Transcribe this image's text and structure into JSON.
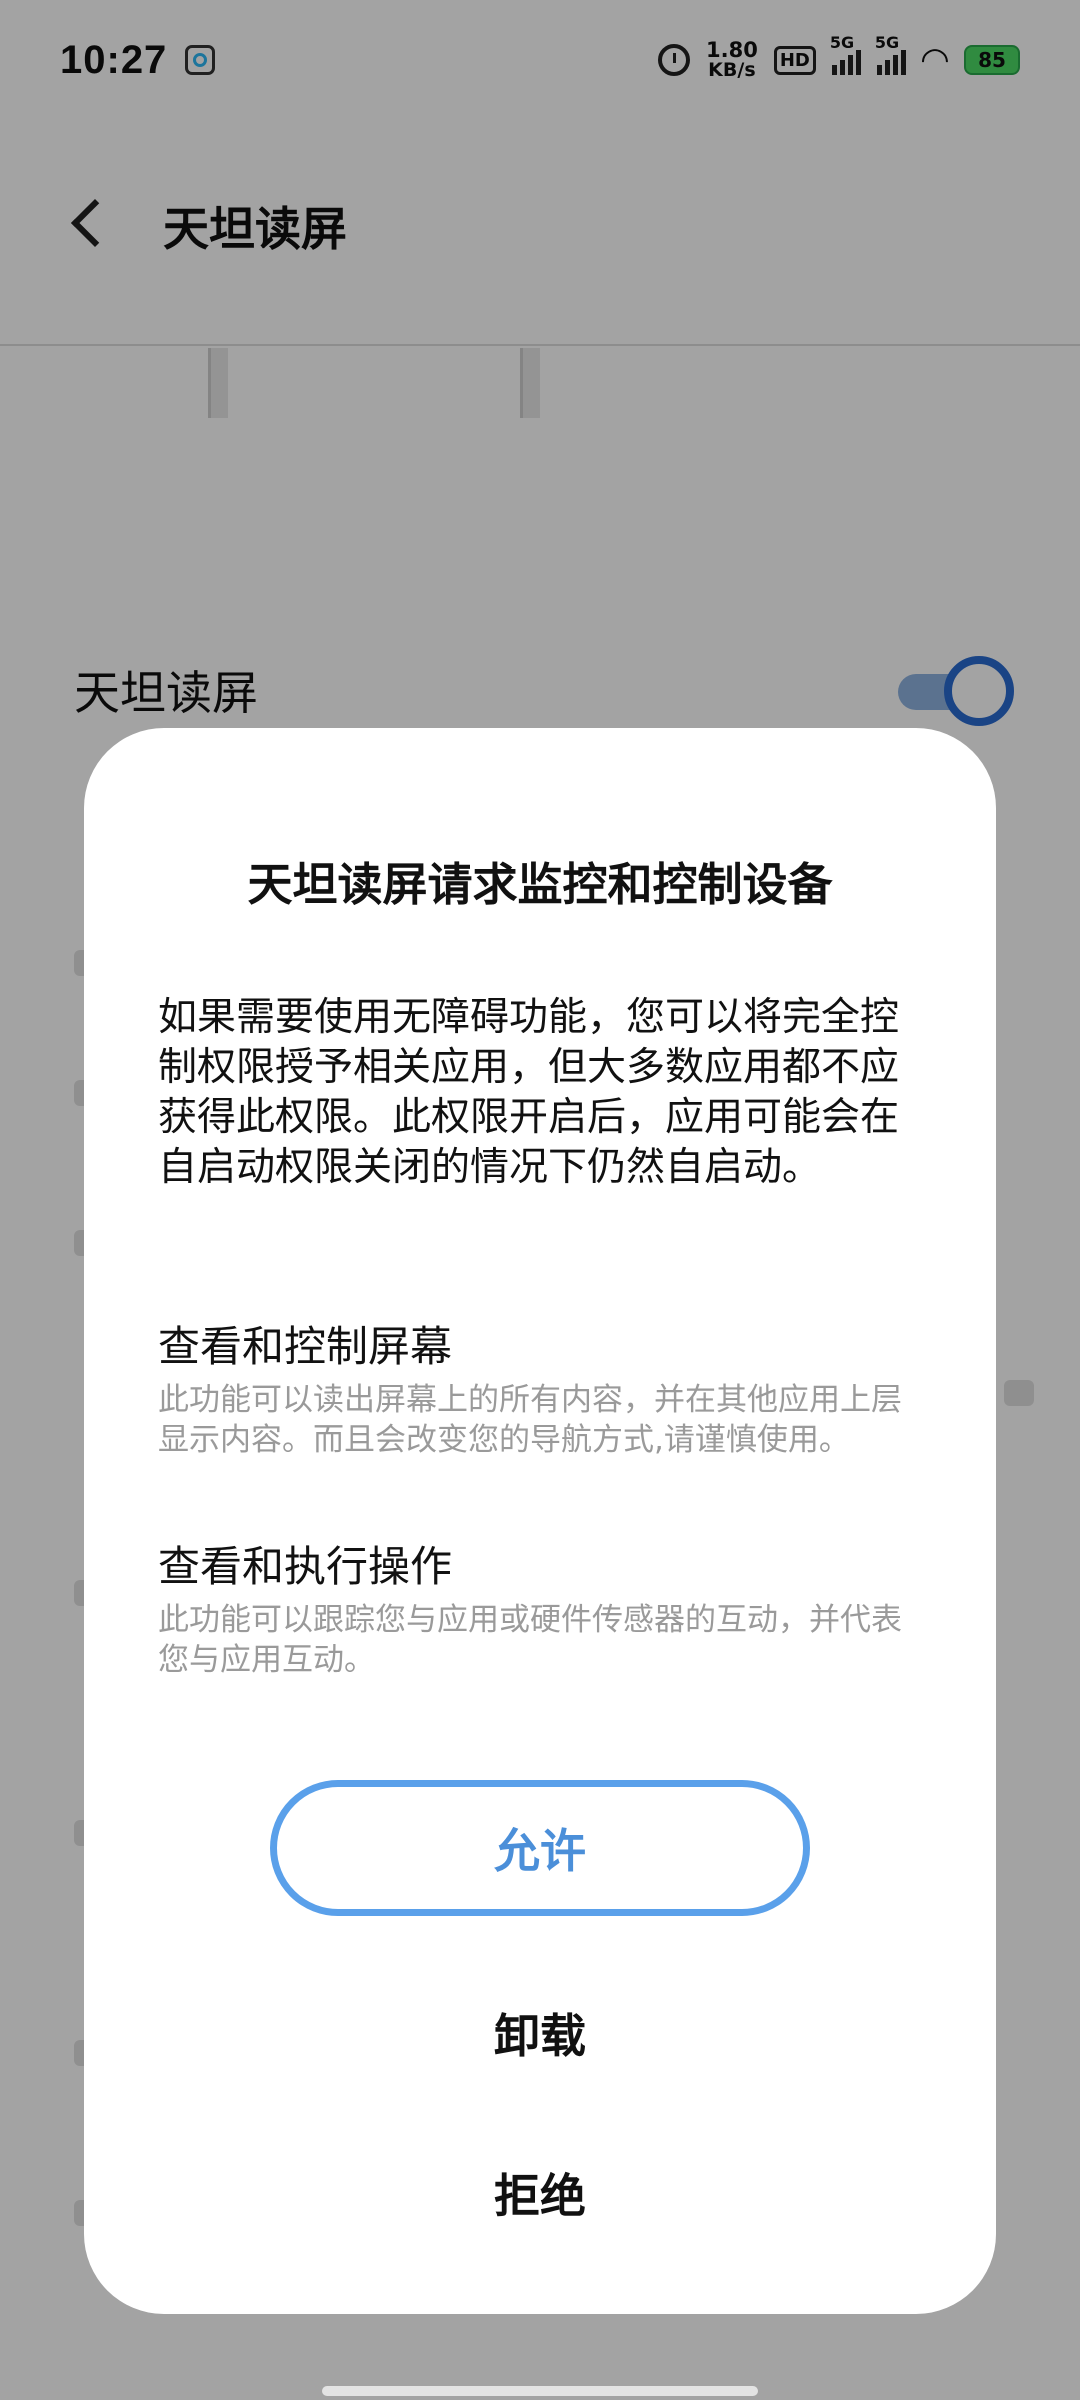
{
  "status_bar": {
    "time": "10:27",
    "net_speed_value": "1.80",
    "net_speed_unit": "KB/s",
    "hd_label": "HD",
    "signal_1_label": "5G",
    "signal_2_label": "5G",
    "battery_level": "85"
  },
  "header": {
    "title": "天坦读屏"
  },
  "background": {
    "service_label": "天坦读屏",
    "toggle_on": true
  },
  "dialog": {
    "title": "天坦读屏请求监控和控制设备",
    "body": "如果需要使用无障碍功能，您可以将完全控制权限授予相关应用，但大多数应用都不应获得此权限。此权限开启后，应用可能会在自启动权限关闭的情况下仍然自启动。",
    "permissions": [
      {
        "title": "查看和控制屏幕",
        "description": "此功能可以读出屏幕上的所有内容，并在其他应用上层显示内容。而且会改变您的导航方式,请谨慎使用。"
      },
      {
        "title": "查看和执行操作",
        "description": "此功能可以跟踪您与应用或硬件传感器的互动，并代表您与应用互动。"
      }
    ],
    "allow_label": "允许",
    "uninstall_label": "卸载",
    "deny_label": "拒绝"
  },
  "colors": {
    "accent": "#4b8fd9",
    "toggle_knob": "#2a6bd1",
    "battery": "#4cd964"
  }
}
